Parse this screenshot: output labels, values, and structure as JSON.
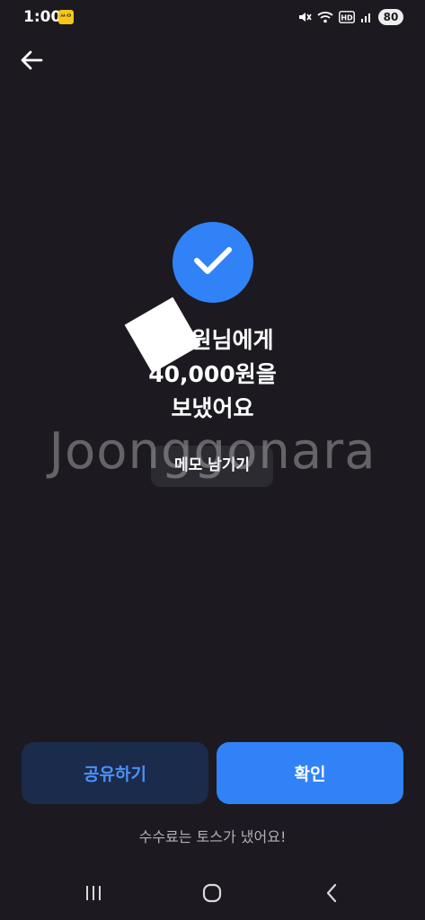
{
  "status_bar": {
    "time": "1:00",
    "app_icon_text": "ᄊᄋ",
    "battery": "80"
  },
  "navigation": {
    "back_icon": "arrow-left-icon"
  },
  "result": {
    "check_icon": "checkmark-icon",
    "accent_color": "#3182f6",
    "line1": "원님에게",
    "line2": "40,000원을",
    "line3": "보냈어요"
  },
  "memo": {
    "label": "메모 남기기"
  },
  "watermark": {
    "text": "Joonggonara"
  },
  "actions": {
    "share_label": "공유하기",
    "confirm_label": "확인"
  },
  "fee_note": "수수료는 토스가 냈어요!",
  "system_nav": {
    "recents_icon": "recents-icon",
    "home_icon": "home-icon",
    "back_icon": "back-chevron-icon"
  }
}
